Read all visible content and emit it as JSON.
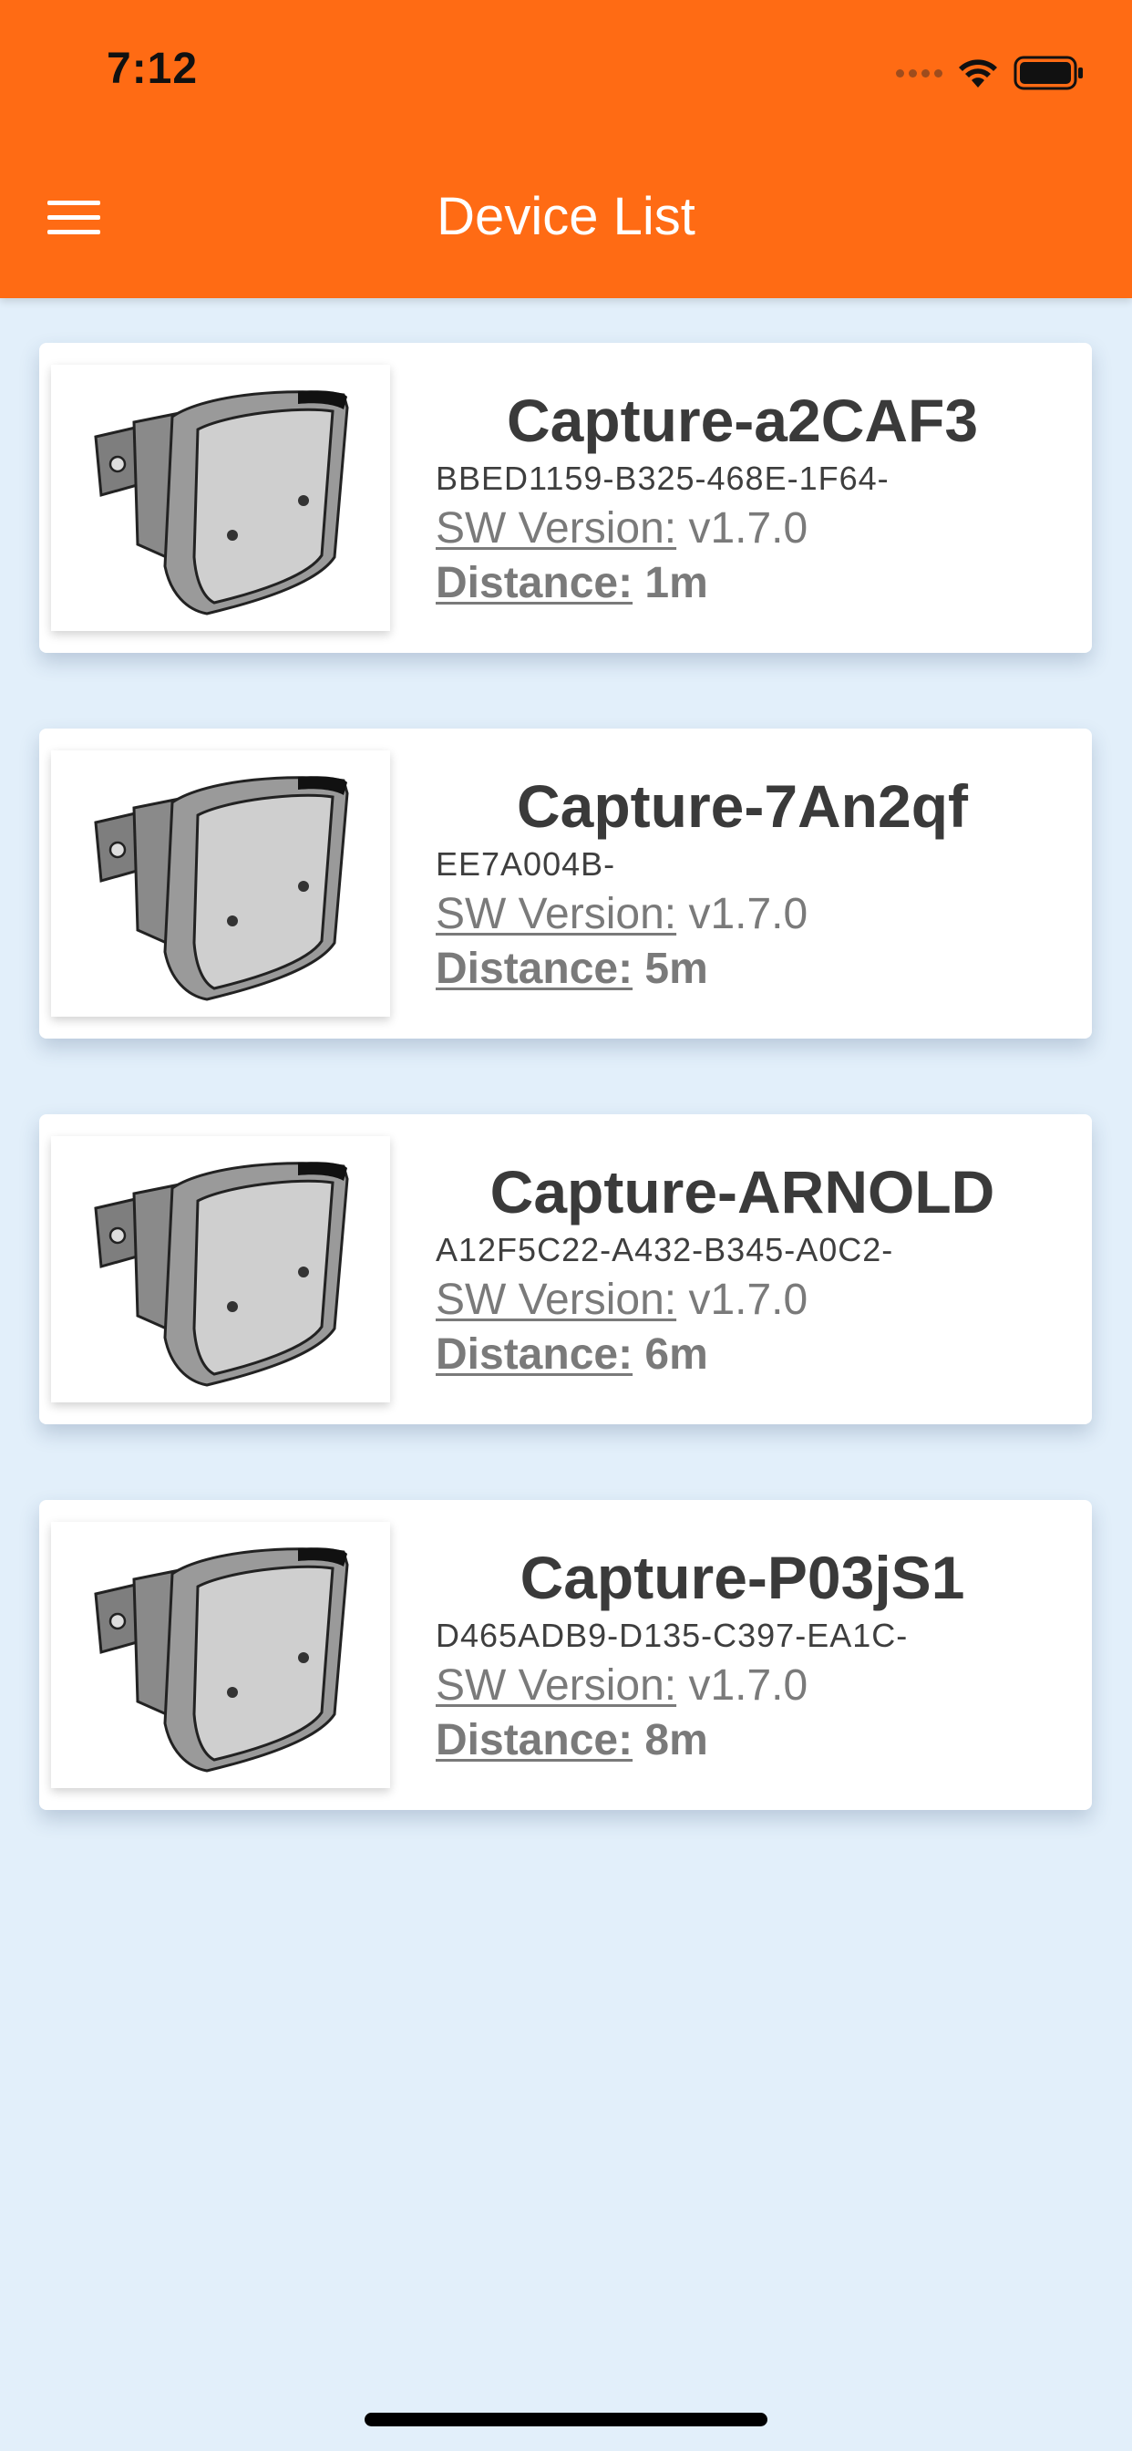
{
  "status_bar": {
    "time": "7:12"
  },
  "header": {
    "title": "Device List",
    "menu_icon": "hamburger-menu-icon",
    "background_color": "#ff6b14"
  },
  "labels": {
    "sw_version": "SW Version:",
    "distance": "Distance:"
  },
  "devices": [
    {
      "name": "Capture-a2CAF3",
      "uuid": "BBED1159-B325-468E-1F64-",
      "sw_version": "v1.7.0",
      "distance": "1m"
    },
    {
      "name": "Capture-7An2qf",
      "uuid": "EE7A004B-",
      "sw_version": "v1.7.0",
      "distance": "5m"
    },
    {
      "name": "Capture-ARNOLD",
      "uuid": "A12F5C22-A432-B345-A0C2-",
      "sw_version": "v1.7.0",
      "distance": "6m"
    },
    {
      "name": "Capture-P03jS1",
      "uuid": "D465ADB9-D135-C397-EA1C-",
      "sw_version": "v1.7.0",
      "distance": "8m"
    }
  ]
}
